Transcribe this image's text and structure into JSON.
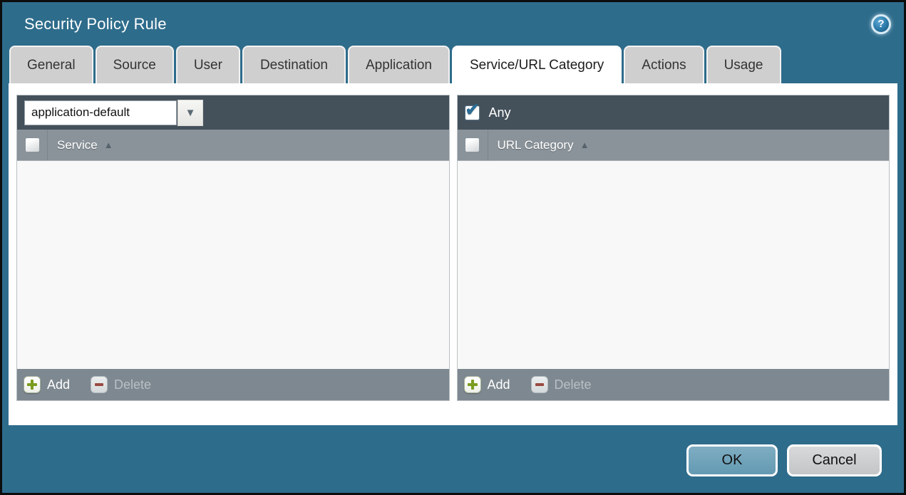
{
  "window": {
    "title": "Security Policy Rule"
  },
  "icons": {
    "help": "?",
    "sort_ascending": "▲",
    "dropdown_arrow": "▼",
    "checkmark": "✔"
  },
  "tabs": [
    {
      "label": "General",
      "active": false
    },
    {
      "label": "Source",
      "active": false
    },
    {
      "label": "User",
      "active": false
    },
    {
      "label": "Destination",
      "active": false
    },
    {
      "label": "Application",
      "active": false
    },
    {
      "label": "Service/URL Category",
      "active": true
    },
    {
      "label": "Actions",
      "active": false
    },
    {
      "label": "Usage",
      "active": false
    }
  ],
  "service_panel": {
    "dropdown_value": "application-default",
    "column_header": "Service",
    "header_checkbox_checked": false,
    "rows": [],
    "add_label": "Add",
    "delete_label": "Delete",
    "delete_enabled": false
  },
  "url_category_panel": {
    "any_label": "Any",
    "any_checked": true,
    "column_header": "URL Category",
    "header_checkbox_checked": false,
    "rows": [],
    "add_label": "Add",
    "delete_label": "Delete",
    "delete_enabled": false
  },
  "dialog_actions": {
    "ok_label": "OK",
    "cancel_label": "Cancel"
  },
  "colors": {
    "dialog_background": "#2e6c8b",
    "panel_toolbar": "#44515b",
    "grid_header": "#8a939a",
    "grid_footer": "#7e8890",
    "active_tab": "#ffffff",
    "inactive_tab": "#cfcfcf",
    "ok_button": "#6fa3bb",
    "cancel_button": "#c9cbcd",
    "add_icon_green": "#7a9c1f",
    "delete_icon_red": "#9a4a42",
    "check_blue": "#2b6d96"
  }
}
